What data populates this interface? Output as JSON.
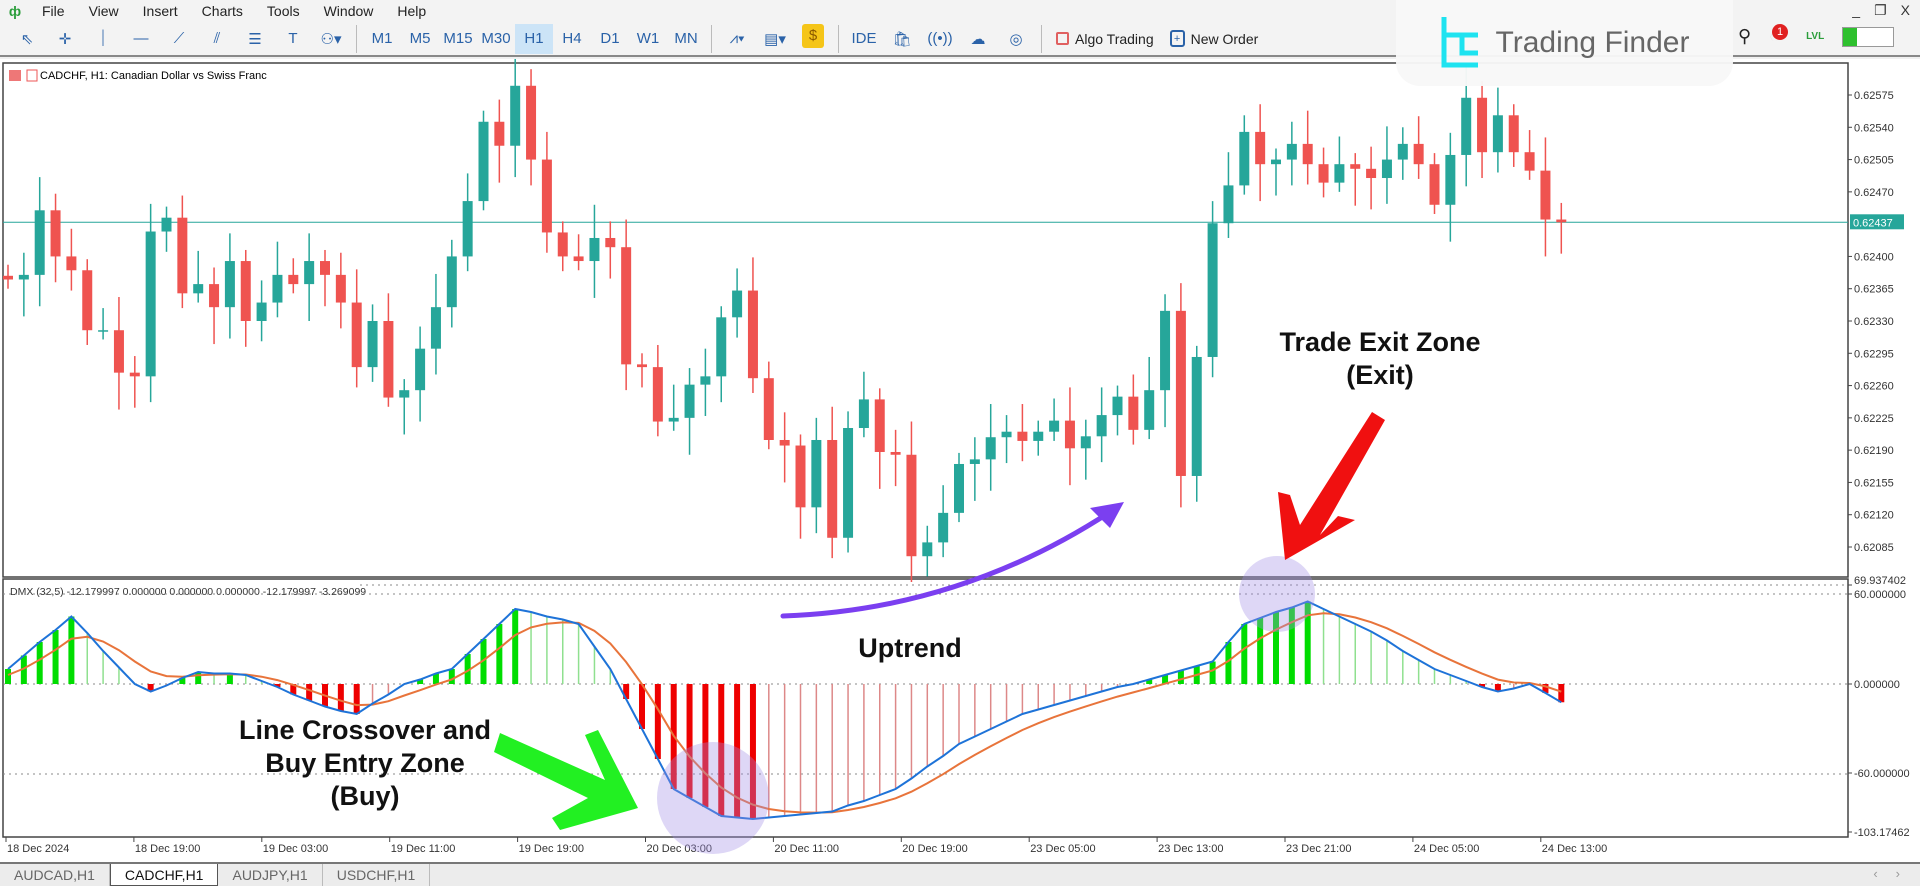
{
  "menu": {
    "items": [
      "File",
      "View",
      "Insert",
      "Charts",
      "Tools",
      "Window",
      "Help"
    ],
    "window_controls": [
      "_",
      "❐",
      "X"
    ]
  },
  "toolbar": {
    "tools": [
      {
        "icon": "cursor-icon",
        "g": "⇖"
      },
      {
        "icon": "crosshair-icon",
        "g": "✛"
      },
      {
        "icon": "vertical-line-icon",
        "g": "⏐"
      },
      {
        "icon": "horizontal-line-icon",
        "g": "—"
      },
      {
        "icon": "trendline-icon",
        "g": "⟋"
      },
      {
        "icon": "channel-icon",
        "g": "⫽"
      },
      {
        "icon": "fibonacci-icon",
        "g": "☰"
      },
      {
        "icon": "text-icon",
        "g": "T"
      },
      {
        "icon": "shapes-icon",
        "g": "⚇▾"
      }
    ],
    "timeframes": [
      "M1",
      "M5",
      "M15",
      "M30",
      "H1",
      "H4",
      "D1",
      "W1",
      "MN"
    ],
    "active_timeframe": "H1",
    "icons": [
      {
        "icon": "chart-type-icon",
        "g": "⩘▾"
      },
      {
        "icon": "indicators-icon",
        "g": "▤▾"
      },
      {
        "icon": "dollar-icon",
        "g": "$"
      }
    ],
    "ide": "IDE",
    "icons2": [
      {
        "icon": "market-bag-icon",
        "g": "🛍"
      },
      {
        "icon": "signals-icon",
        "g": "((•))"
      },
      {
        "icon": "vps-cloud-icon",
        "g": "☁"
      },
      {
        "icon": "network-icon",
        "g": "◎"
      }
    ],
    "algo_trading": "Algo Trading",
    "new_order": "New Order",
    "notifications_count": "1",
    "lvl": "LVL"
  },
  "logo": {
    "text": "Trading Finder"
  },
  "chart": {
    "title": "CADCHF, H1:  Canadian Dollar vs Swiss Franc",
    "current_price": "0.62437",
    "indicator_label": "DMX (32,5) -12.179997 0.000000 0.000000 0.000000 -12.179997 -3.269099",
    "colors": {
      "bull": "#26a69a",
      "bear": "#ef5350",
      "main_line": "#1e73d8",
      "signal_line": "#e8743b",
      "hist_up": "#00dd00",
      "hist_down": "#ee0000"
    }
  },
  "chart_data": {
    "type": "candlestick",
    "symbol": "CADCHF",
    "timeframe": "H1",
    "price_ticks": [
      "0.62575",
      "0.62540",
      "0.62505",
      "0.62470",
      "0.62400",
      "0.62365",
      "0.62330",
      "0.62295",
      "0.62260",
      "0.62225",
      "0.62190",
      "0.62155",
      "0.62120",
      "0.62085"
    ],
    "price_range": [
      0.6205,
      0.6261
    ],
    "time_ticks": [
      "18 Dec 2024",
      "18 Dec 19:00",
      "19 Dec 03:00",
      "19 Dec 11:00",
      "19 Dec 19:00",
      "20 Dec 03:00",
      "20 Dec 11:00",
      "20 Dec 19:00",
      "23 Dec 05:00",
      "23 Dec 13:00",
      "23 Dec 21:00",
      "24 Dec 05:00",
      "24 Dec 13:00"
    ],
    "closes": [
      0.62375,
      0.6238,
      0.6245,
      0.624,
      0.62385,
      0.6232,
      0.6232,
      0.62274,
      0.6227,
      0.62427,
      0.62442,
      0.6236,
      0.6237,
      0.62345,
      0.62395,
      0.6233,
      0.6235,
      0.6238,
      0.6237,
      0.62395,
      0.6238,
      0.6235,
      0.6228,
      0.6233,
      0.62247,
      0.62255,
      0.623,
      0.62345,
      0.624,
      0.6246,
      0.62546,
      0.6252,
      0.62585,
      0.62505,
      0.62426,
      0.624,
      0.62395,
      0.6242,
      0.6241,
      0.62283,
      0.6228,
      0.62221,
      0.62225,
      0.62261,
      0.6227,
      0.62334,
      0.62363,
      0.62268,
      0.62201,
      0.62195,
      0.62128,
      0.62201,
      0.62095,
      0.62214,
      0.62245,
      0.62188,
      0.62185,
      0.62075,
      0.6209,
      0.62122,
      0.62175,
      0.6218,
      0.62204,
      0.6221,
      0.622,
      0.6221,
      0.62222,
      0.62192,
      0.62205,
      0.62228,
      0.62248,
      0.62212,
      0.62255,
      0.62341,
      0.62162,
      0.62291,
      0.62436,
      0.62477,
      0.62535,
      0.625,
      0.62505,
      0.62522,
      0.625,
      0.6248,
      0.625,
      0.62495,
      0.62485,
      0.62505,
      0.62522,
      0.625,
      0.62456,
      0.6251,
      0.62572,
      0.62513,
      0.62553,
      0.62513,
      0.62493,
      0.6244,
      0.62437
    ],
    "indicator": {
      "name": "DMX (32,5)",
      "ticks": [
        "69.937402",
        "60.000000",
        "0.000000",
        "-60.000000",
        "-103.17462"
      ],
      "levels": [
        60,
        0,
        -60
      ],
      "range": [
        -103.17462,
        69.937402
      ],
      "signal_period": 5,
      "main": [
        10,
        19,
        28,
        36,
        45,
        34,
        22,
        11,
        0,
        -5,
        -1,
        4,
        8,
        7,
        7,
        6,
        2,
        -2,
        -7,
        -11,
        -15,
        -18,
        -20,
        -13,
        -7,
        0,
        3,
        7,
        10,
        20,
        30,
        40,
        50,
        48,
        45,
        43,
        40,
        25,
        10,
        -10,
        -30,
        -50,
        -70,
        -76,
        -82,
        -88,
        -89,
        -90,
        -89,
        -88,
        -87,
        -86,
        -85,
        -81,
        -78,
        -74,
        -70,
        -63,
        -55,
        -48,
        -40,
        -35,
        -30,
        -25,
        -20,
        -17,
        -14,
        -11,
        -8,
        -5,
        -2,
        0,
        3,
        6,
        9,
        12,
        15,
        28,
        40,
        44,
        48,
        51,
        55,
        50,
        45,
        40,
        35,
        29,
        22,
        16,
        10,
        6,
        2,
        -2,
        -5,
        -3,
        0,
        -6,
        -12.18
      ]
    }
  },
  "annotations": {
    "exit": [
      "Trade Exit Zone",
      "(Exit)"
    ],
    "uptrend": "Uptrend",
    "entry": [
      "Line Crossover and",
      "Buy Entry Zone",
      "(Buy)"
    ]
  },
  "tabs": [
    {
      "label": "AUDCAD,H1"
    },
    {
      "label": "CADCHF,H1",
      "active": true
    },
    {
      "label": "AUDJPY,H1"
    },
    {
      "label": "USDCHF,H1"
    }
  ]
}
